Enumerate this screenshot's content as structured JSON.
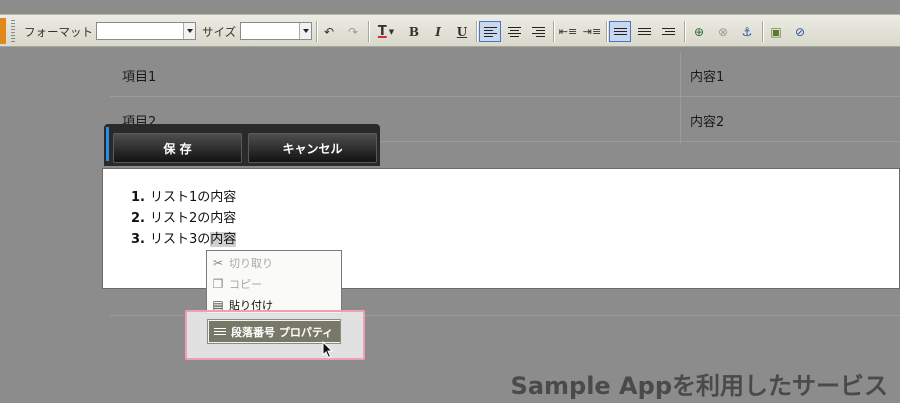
{
  "toolbar": {
    "format_label": "フォーマット",
    "format_value": "",
    "size_label": "サイズ",
    "size_value": "",
    "bold": "B",
    "italic": "I",
    "underline": "U",
    "undo_icon": "↶",
    "redo_icon": "↷",
    "font_color": "T",
    "image_icon": "▣",
    "flash_icon": "⊘",
    "anchor_icon": "⚓",
    "link_icon": "⊕",
    "unlink_icon": "⊗"
  },
  "table": {
    "rows": [
      {
        "item": "項目1",
        "content": "内容1"
      },
      {
        "item": "項目2",
        "content": "内容2"
      }
    ]
  },
  "panel": {
    "save": "保 存",
    "cancel": "キャンセル"
  },
  "editor": {
    "list": [
      {
        "num": "1.",
        "text": "リスト1の内容"
      },
      {
        "num": "2.",
        "text": "リスト2の内容"
      },
      {
        "num": "3.",
        "text_before": "リスト3の",
        "text_selected": "内容"
      }
    ]
  },
  "context_menu": {
    "items": [
      {
        "label": "切り取り",
        "icon": "scissors-icon",
        "enabled": false
      },
      {
        "label": "コピー",
        "icon": "copy-icon",
        "enabled": false
      },
      {
        "label": "貼り付け",
        "icon": "paste-icon",
        "enabled": true
      }
    ],
    "highlighted_item": "段落番号 プロパティ"
  },
  "brand": "Sample Appを利用したサービス",
  "colors": {
    "accent_orange": "#e0881c",
    "active_blue": "#4a78c4",
    "panel_blue": "#2d8de6",
    "highlight_pink": "#f0a0b0"
  }
}
